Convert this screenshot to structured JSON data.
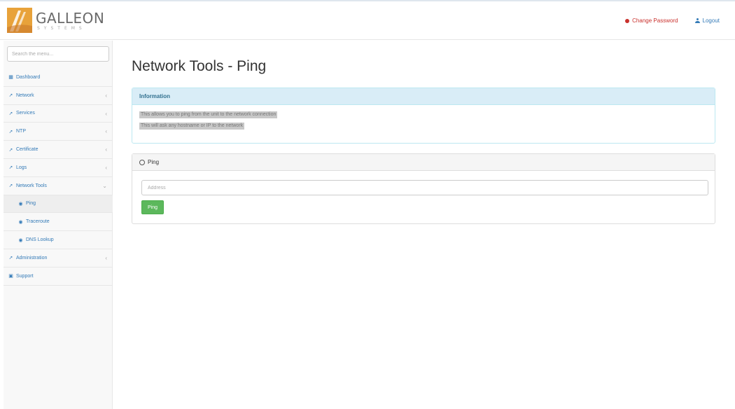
{
  "brand": {
    "name": "GALLEON",
    "tagline": "SYSTEMS"
  },
  "header": {
    "change_password": "Change Password",
    "logout": "Logout",
    "colors": {
      "danger": "#c9302c",
      "link": "#337ab7"
    }
  },
  "sidebar": {
    "search_placeholder": "Search the menu...",
    "items": [
      {
        "label": "Dashboard",
        "icon": "dashboard-icon",
        "has_arrow": false
      },
      {
        "label": "Network",
        "icon": "wrench-icon",
        "has_arrow": true
      },
      {
        "label": "Services",
        "icon": "wrench-icon",
        "has_arrow": true
      },
      {
        "label": "NTP",
        "icon": "wrench-icon",
        "has_arrow": true
      },
      {
        "label": "Certificate",
        "icon": "wrench-icon",
        "has_arrow": true
      },
      {
        "label": "Logs",
        "icon": "wrench-icon",
        "has_arrow": true
      },
      {
        "label": "Network Tools",
        "icon": "wrench-icon",
        "has_arrow": true,
        "expanded": true
      },
      {
        "label": "Ping",
        "icon": "globe-icon",
        "sub": true,
        "active": true
      },
      {
        "label": "Traceroute",
        "icon": "globe-icon",
        "sub": true
      },
      {
        "label": "DNS Lookup",
        "icon": "globe-icon",
        "sub": true
      },
      {
        "label": "Administration",
        "icon": "wrench-icon",
        "has_arrow": true
      },
      {
        "label": "Support",
        "icon": "support-icon",
        "has_arrow": false
      }
    ]
  },
  "main": {
    "title": "Network Tools - Ping",
    "info_panel": {
      "heading": "Information",
      "lines": [
        "This allows you to ping from the unit to the network connection",
        "This will ask any hostname or IP to the network"
      ]
    },
    "ping_panel": {
      "heading": "Ping",
      "address_placeholder": "Address",
      "address_value": "",
      "button_label": "Ping",
      "button_color": "#5cb85c"
    }
  }
}
